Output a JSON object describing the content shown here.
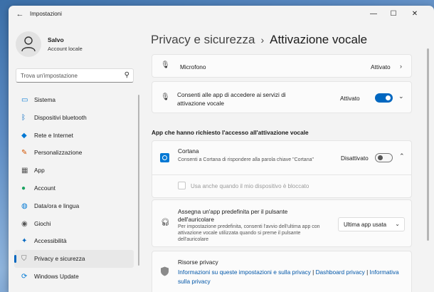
{
  "window": {
    "title": "Impostazioni"
  },
  "user": {
    "name": "Salvo",
    "account_type": "Account locale"
  },
  "search": {
    "placeholder": "Trova un'impostazione"
  },
  "sidebar": {
    "items": [
      {
        "label": "Sistema",
        "icon": "monitor-icon",
        "color": "#0078d4"
      },
      {
        "label": "Dispositivi bluetooth",
        "icon": "bluetooth-icon",
        "color": "#0067c0"
      },
      {
        "label": "Rete e Internet",
        "icon": "wifi-icon",
        "color": "#0078d4"
      },
      {
        "label": "Personalizzazione",
        "icon": "brush-icon",
        "color": "#d35400"
      },
      {
        "label": "App",
        "icon": "apps-icon",
        "color": "#555555"
      },
      {
        "label": "Account",
        "icon": "person-icon",
        "color": "#1aa260"
      },
      {
        "label": "Data/ora e lingua",
        "icon": "globe-icon",
        "color": "#0078d4"
      },
      {
        "label": "Giochi",
        "icon": "gamepad-icon",
        "color": "#555555"
      },
      {
        "label": "Accessibilità",
        "icon": "accessibility-icon",
        "color": "#0067c0"
      },
      {
        "label": "Privacy e sicurezza",
        "icon": "shield-icon",
        "color": "#707070",
        "active": true
      },
      {
        "label": "Windows Update",
        "icon": "update-icon",
        "color": "#0078d4"
      }
    ]
  },
  "breadcrumb": {
    "parent": "Privacy e sicurezza",
    "separator": "›",
    "current": "Attivazione vocale"
  },
  "microfono": {
    "label": "Microfono",
    "value": "Attivato"
  },
  "consenti": {
    "label": "Consenti alle app di accedere ai servizi di attivazione vocale",
    "value": "Attivato",
    "toggle": true
  },
  "section": {
    "title": "App che hanno richiesto l'accesso all'attivazione vocale"
  },
  "cortana": {
    "name": "Cortana",
    "description": "Consenti a Cortana di rispondere alla parola chiave \"Cortana\"",
    "value": "Disattivato",
    "toggle": false,
    "sub_option": "Usa anche quando il mio dispositivo è bloccato"
  },
  "auricolare": {
    "title": "Assegna un'app predefinita per il pulsante dell'auricolare",
    "description": "Per impostazione predefinita, consenti l'avvio dell'ultima app con attivazione vocale utilizzata quando si preme il pulsante dell'auricolare",
    "dropdown_value": "Ultima app usata"
  },
  "risorse": {
    "title": "Risorse privacy",
    "links": [
      "Informazioni su queste impostazioni e sulla privacy",
      "Dashboard privacy",
      "Informativa sulla privacy"
    ],
    "separator": "|"
  },
  "colors": {
    "accent": "#0067c0",
    "link": "#0056a8"
  }
}
